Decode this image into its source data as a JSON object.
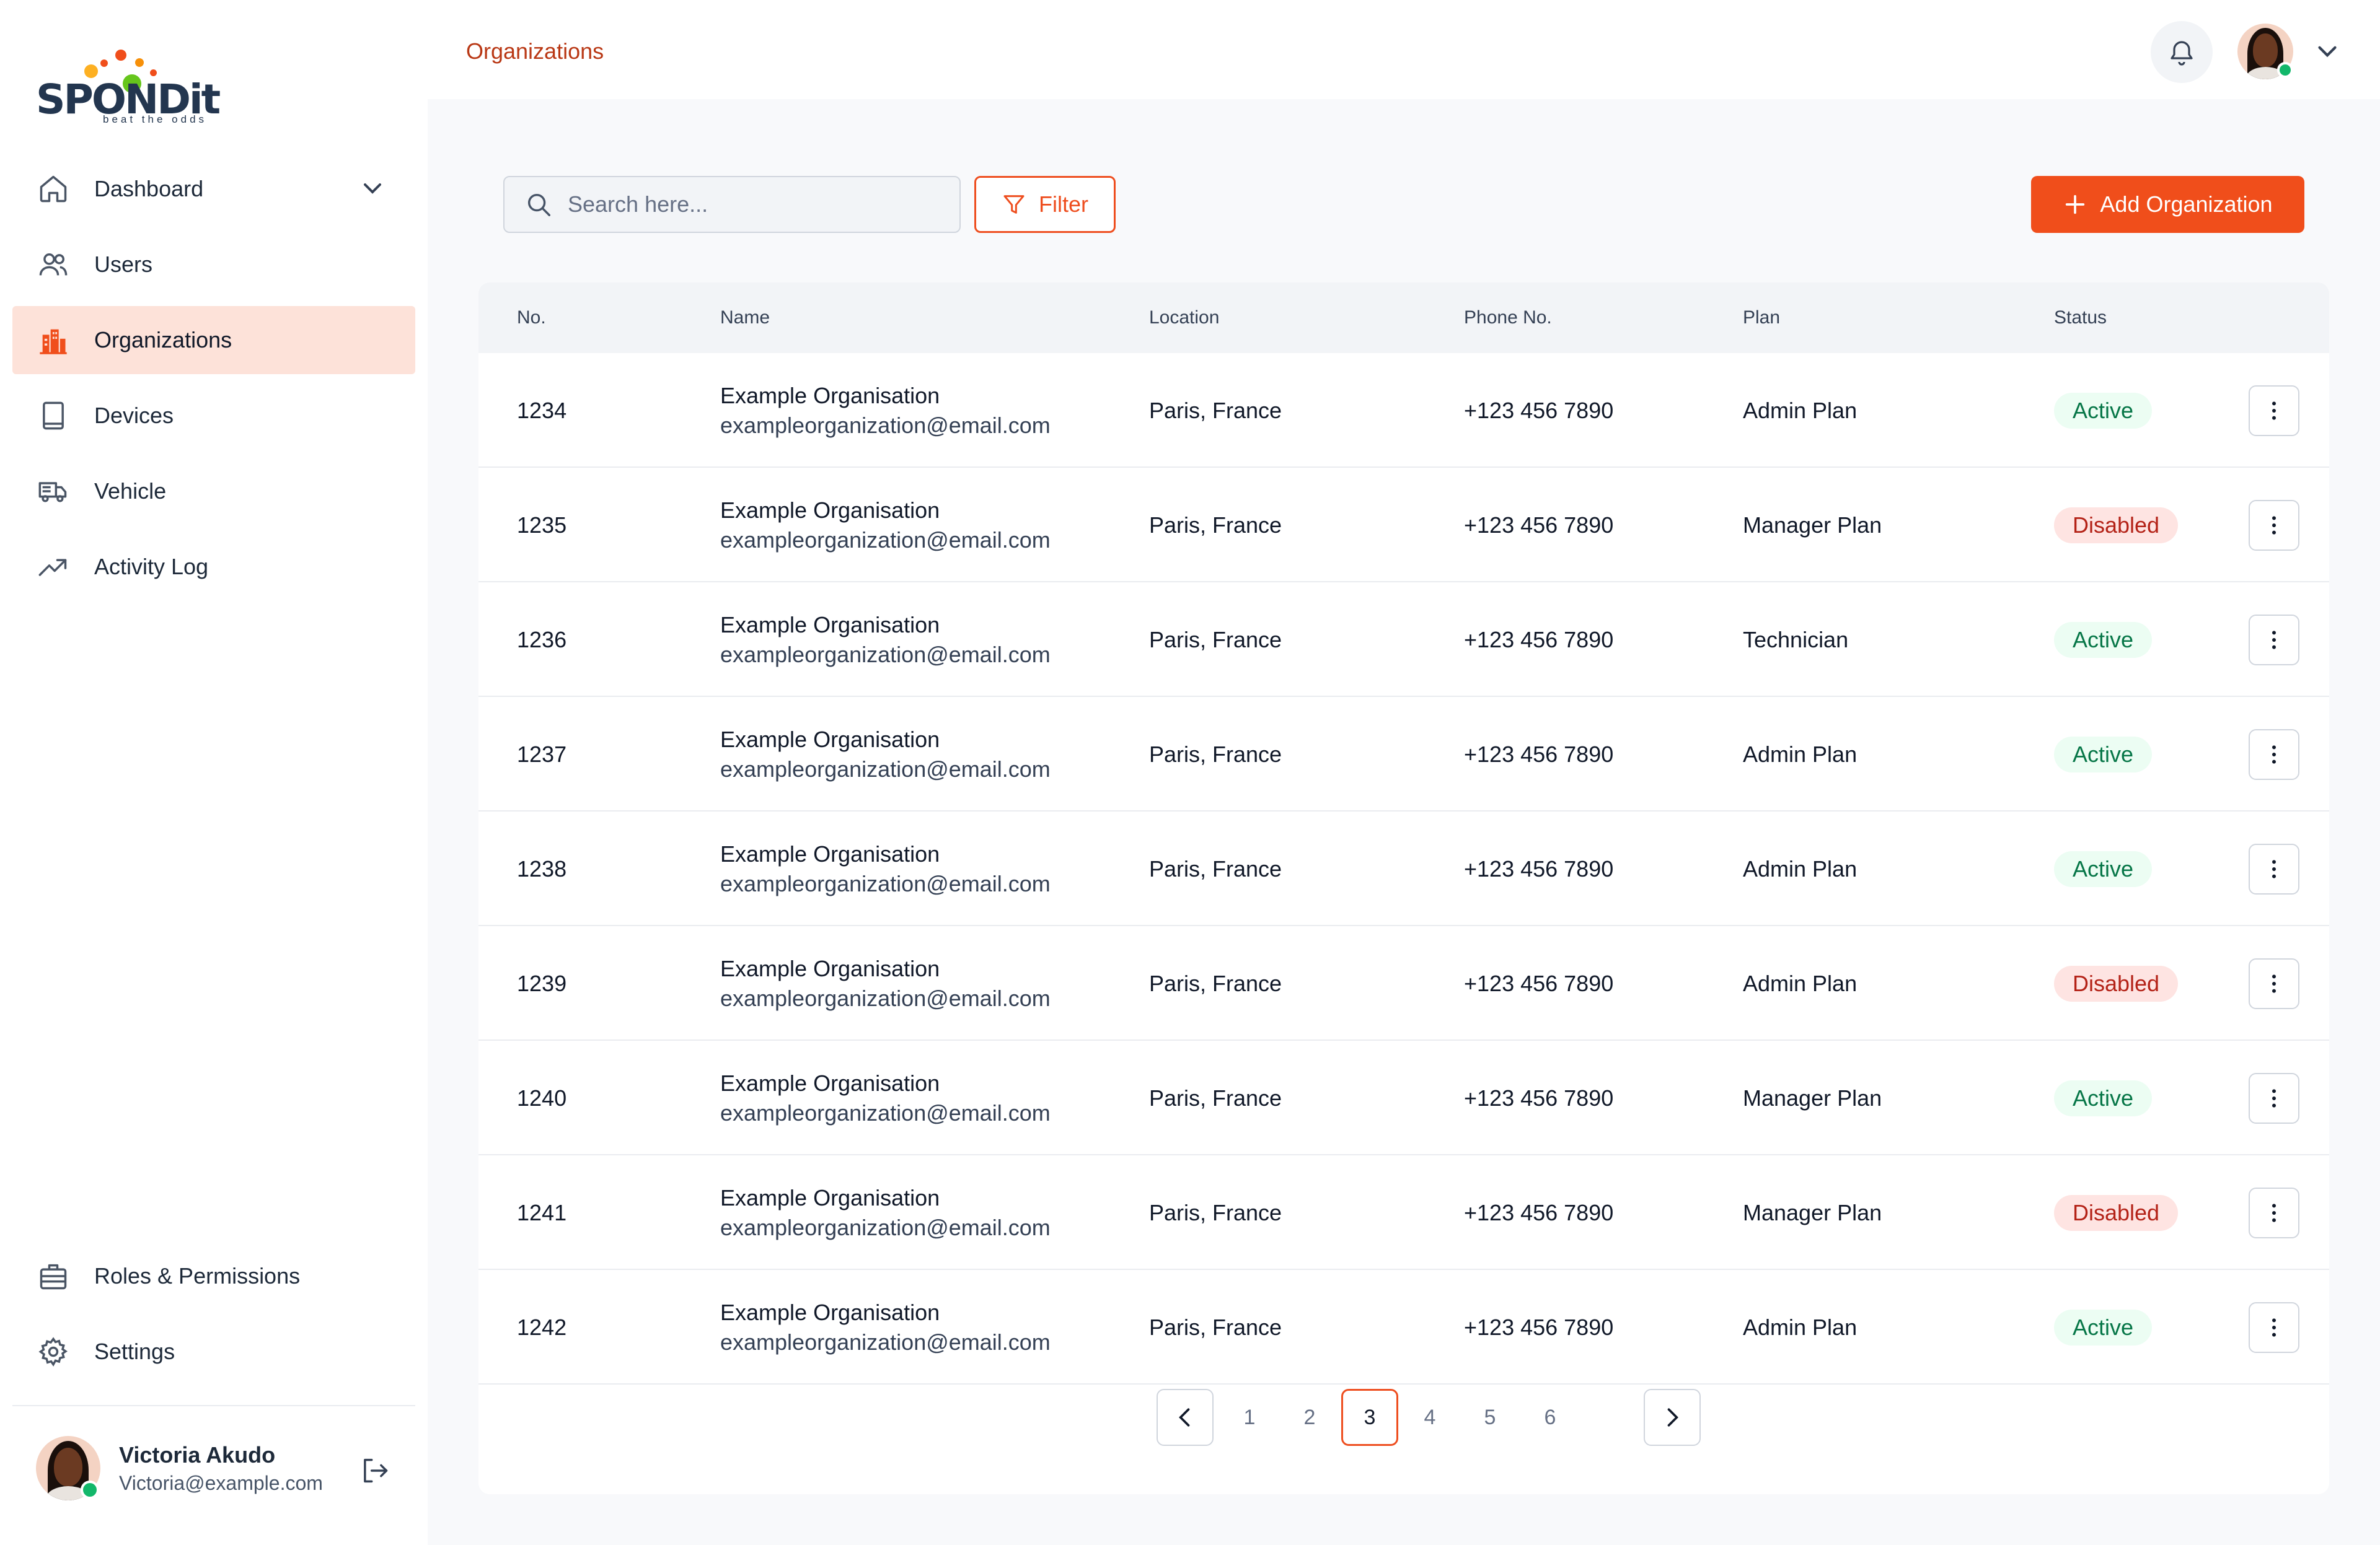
{
  "brand": {
    "name": "SPONDit",
    "tagline": "beat the odds",
    "accent": "#F04E1B",
    "active_bg": "#FDE2D9"
  },
  "sidebar": {
    "items": [
      {
        "label": "Dashboard",
        "icon": "home-icon",
        "has_dropdown": true
      },
      {
        "label": "Users",
        "icon": "users-icon"
      },
      {
        "label": "Organizations",
        "icon": "building-icon",
        "active": true
      },
      {
        "label": "Devices",
        "icon": "tablet-icon"
      },
      {
        "label": "Vehicle",
        "icon": "truck-icon"
      },
      {
        "label": "Activity Log",
        "icon": "trend-up-icon"
      }
    ],
    "bottom_items": [
      {
        "label": "Roles & Permissions",
        "icon": "briefcase-icon"
      },
      {
        "label": "Settings",
        "icon": "gear-icon"
      }
    ],
    "user": {
      "name": "Victoria Akudo",
      "email": "Victoria@example.com"
    }
  },
  "header": {
    "breadcrumb": "Organizations"
  },
  "toolbar": {
    "search_placeholder": "Search here...",
    "filter_label": "Filter",
    "add_label": "Add Organization"
  },
  "table": {
    "columns": [
      "No.",
      "Name",
      "Location",
      "Phone No.",
      "Plan",
      "Status"
    ],
    "rows": [
      {
        "no": "1234",
        "name": "Example Organisation",
        "email": "exampleorganization@email.com",
        "location": "Paris, France",
        "phone": "+123 456 7890",
        "plan": "Admin Plan",
        "status": "Active"
      },
      {
        "no": "1235",
        "name": "Example Organisation",
        "email": "exampleorganization@email.com",
        "location": "Paris, France",
        "phone": "+123 456 7890",
        "plan": "Manager Plan",
        "status": "Disabled"
      },
      {
        "no": "1236",
        "name": "Example Organisation",
        "email": "exampleorganization@email.com",
        "location": "Paris, France",
        "phone": "+123 456 7890",
        "plan": "Technician",
        "status": "Active"
      },
      {
        "no": "1237",
        "name": "Example Organisation",
        "email": "exampleorganization@email.com",
        "location": "Paris, France",
        "phone": "+123 456 7890",
        "plan": "Admin Plan",
        "status": "Active"
      },
      {
        "no": "1238",
        "name": "Example Organisation",
        "email": "exampleorganization@email.com",
        "location": "Paris, France",
        "phone": "+123 456 7890",
        "plan": "Admin Plan",
        "status": "Active"
      },
      {
        "no": "1239",
        "name": "Example Organisation",
        "email": "exampleorganization@email.com",
        "location": "Paris, France",
        "phone": "+123 456 7890",
        "plan": "Admin Plan",
        "status": "Disabled"
      },
      {
        "no": "1240",
        "name": "Example Organisation",
        "email": "exampleorganization@email.com",
        "location": "Paris, France",
        "phone": "+123 456 7890",
        "plan": "Manager Plan",
        "status": "Active"
      },
      {
        "no": "1241",
        "name": "Example Organisation",
        "email": "exampleorganization@email.com",
        "location": "Paris, France",
        "phone": "+123 456 7890",
        "plan": "Manager Plan",
        "status": "Disabled"
      },
      {
        "no": "1242",
        "name": "Example Organisation",
        "email": "exampleorganization@email.com",
        "location": "Paris, France",
        "phone": "+123 456 7890",
        "plan": "Admin Plan",
        "status": "Active"
      }
    ]
  },
  "pagination": {
    "pages": [
      "1",
      "2",
      "3",
      "4",
      "5",
      "6"
    ],
    "current": "3"
  }
}
